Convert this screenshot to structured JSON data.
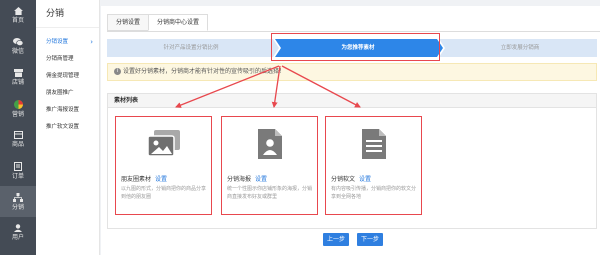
{
  "nav": {
    "items": [
      {
        "label": "首页",
        "icon": "home-icon"
      },
      {
        "label": "微信",
        "icon": "wechat-icon"
      },
      {
        "label": "店铺",
        "icon": "store-icon"
      },
      {
        "label": "营销",
        "icon": "marketing-icon"
      },
      {
        "label": "商品",
        "icon": "product-icon"
      },
      {
        "label": "订单",
        "icon": "order-icon"
      },
      {
        "label": "分销",
        "icon": "distribution-icon",
        "active": true
      },
      {
        "label": "用户",
        "icon": "user-icon"
      }
    ]
  },
  "subnav": {
    "title": "分销",
    "items": [
      "分销设置",
      "分销商管理",
      "佣金提现管理",
      "朋友圈推广",
      "推广海报设置",
      "推广软文设置"
    ],
    "active_chevron": "›"
  },
  "tabs": [
    "分销设置",
    "分销商中心设置"
  ],
  "steps": [
    "针对产品设置分销比例",
    "为您推荐素材",
    "立即发展分销商"
  ],
  "notice": {
    "icon": "info-icon",
    "text": "设置好分销素材，分销商才能有针对性的宣传吸引的后选择！"
  },
  "panel": {
    "title": "素材列表"
  },
  "cards": [
    {
      "name": "朋友圈素材",
      "link": "设置",
      "desc": "以九图的形式，分销商把你的商品分享到他的朋友圈",
      "icon": "photos-icon"
    },
    {
      "name": "分销海报",
      "link": "设置",
      "desc": "统一个性图示你店铺形象的海报，分销商直接发布好友或群里",
      "icon": "poster-icon"
    },
    {
      "name": "分销软文",
      "link": "设置",
      "desc": "有内容吸引传播，分销商把你的软文分享到全网各地",
      "icon": "article-icon"
    }
  ],
  "buttons": {
    "prev": "上一步",
    "next": "下一步"
  },
  "colors": {
    "accent": "#2f7fe0",
    "highlight": "#e8484e",
    "step_active": "#2d86e8",
    "step_inactive": "#d9e6f6"
  }
}
